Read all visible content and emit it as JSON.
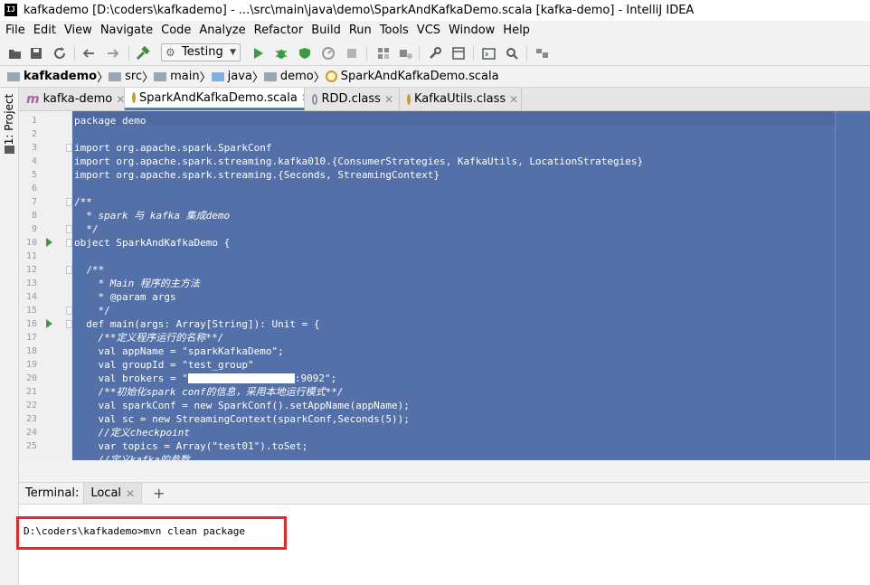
{
  "window": {
    "title": "kafkademo [D:\\coders\\kafkademo] - ...\\src\\main\\java\\demo\\SparkAndKafkaDemo.scala [kafka-demo] - IntelliJ IDEA",
    "logo_text": "IJ"
  },
  "menu": [
    "File",
    "Edit",
    "View",
    "Navigate",
    "Code",
    "Analyze",
    "Refactor",
    "Build",
    "Run",
    "Tools",
    "VCS",
    "Window",
    "Help"
  ],
  "toolbar": {
    "run_config": "Testing",
    "icons": [
      "open-icon",
      "save-icon",
      "sync-icon",
      "back-icon",
      "forward-icon",
      "build-hammer-icon",
      "run-icon",
      "debug-icon",
      "coverage-icon",
      "profile-icon",
      "stop-icon",
      "project-structure-icon",
      "sdk-icon",
      "terminal-icon",
      "search-icon",
      "layout-icon"
    ]
  },
  "breadcrumb": {
    "project": "kafkademo",
    "items": [
      "src",
      "main",
      "java",
      "demo",
      "SparkAndKafkaDemo.scala"
    ]
  },
  "side": {
    "project_tab": "1: Project"
  },
  "tabs": [
    {
      "label": "kafka-demo",
      "icon": "maven-icon",
      "active": false
    },
    {
      "label": "SparkAndKafkaDemo.scala",
      "icon": "scala-file-icon",
      "active": true
    },
    {
      "label": "RDD.class",
      "icon": "class-file-icon",
      "active": false
    },
    {
      "label": "KafkaUtils.class",
      "icon": "class-file-icon",
      "active": false
    }
  ],
  "code": {
    "line_numbers": [
      "1",
      "2",
      "3",
      "4",
      "5",
      "6",
      "7",
      "8",
      "9",
      "10",
      "11",
      "12",
      "13",
      "14",
      "15",
      "16",
      "17",
      "18",
      "19",
      "20",
      "21",
      "22",
      "23",
      "24",
      "25"
    ],
    "lines": [
      "package demo",
      "",
      "import org.apache.spark.SparkConf",
      "import org.apache.spark.streaming.kafka010.{ConsumerStrategies, KafkaUtils, LocationStrategies}",
      "import org.apache.spark.streaming.{Seconds, StreamingContext}",
      "",
      "/**",
      "  * spark 与 kafka 集成demo",
      "  */",
      "object SparkAndKafkaDemo {",
      "",
      "  /**",
      "    * Main 程序的主方法",
      "    * @param args",
      "    */",
      "  def main(args: Array[String]): Unit = {",
      "    /**定义程序运行的名称**/",
      "    val appName = \"sparkKafkaDemo\";",
      "    val groupId = \"test_group\"",
      "    val brokers = \"",
      "    /**初始化spark conf的信息，采用本地运行模式**/",
      "    val sparkConf = new SparkConf().setAppName(appName);",
      "    val sc = new StreamingContext(sparkConf,Seconds(5));",
      "    //定义checkpoint",
      "    var topics = Array(\"test01\").toSet;",
      "    //定义kafka的参数"
    ],
    "brokers_suffix": ":9092\";"
  },
  "terminal": {
    "label": "Terminal:",
    "tab": "Local",
    "add": "+",
    "command_line": "D:\\coders\\kafkademo>mvn clean package"
  },
  "colors": {
    "selection": "#5470a9",
    "highlight_box": "#e8272a",
    "active_tab_underline": "#4083c9"
  }
}
